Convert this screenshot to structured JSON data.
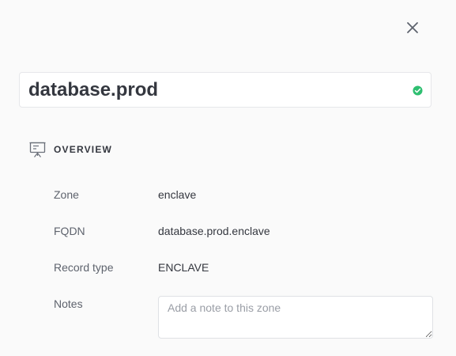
{
  "header": {
    "close_icon": "close-icon"
  },
  "record": {
    "title": "database.prod",
    "status_color": "#2fbf71",
    "status_icon": "check-circle-icon"
  },
  "overview": {
    "section_title": "OVERVIEW",
    "section_icon": "presentation-board-icon",
    "fields": {
      "zone": {
        "label": "Zone",
        "value": "enclave"
      },
      "fqdn": {
        "label": "FQDN",
        "value": "database.prod.enclave"
      },
      "record_type": {
        "label": "Record type",
        "value": "ENCLAVE"
      },
      "notes": {
        "label": "Notes",
        "value": "",
        "placeholder": "Add a note to this zone"
      }
    }
  }
}
